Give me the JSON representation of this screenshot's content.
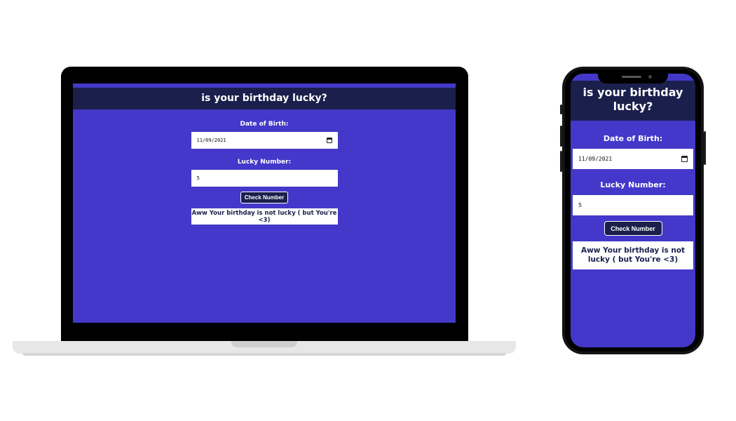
{
  "app": {
    "title": "is your birthday lucky?",
    "dob_label": "Date of Birth:",
    "dob_value": "11/09/2021",
    "lucky_label": "Lucky Number:",
    "lucky_value": "5",
    "check_button_label": "Check Number",
    "result_text": "Aww Your birthday is not lucky ( but You're <3)"
  },
  "colors": {
    "app_background": "#4338c9",
    "header_background": "#1a1f4b",
    "device_frame": "#000000"
  },
  "icons": {
    "date_picker": "calendar-icon"
  }
}
